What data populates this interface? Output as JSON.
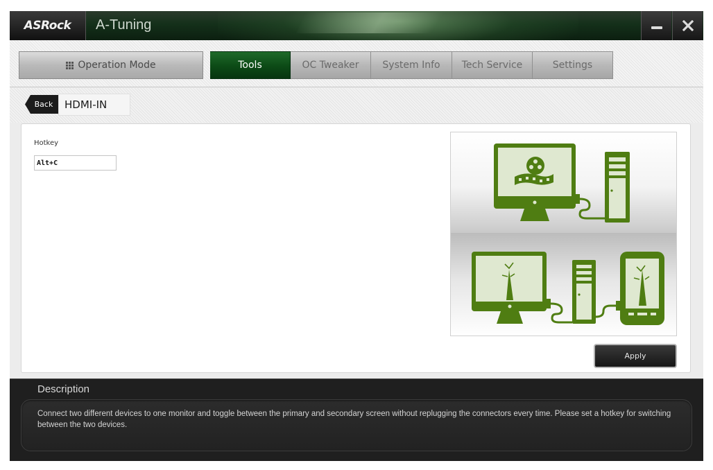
{
  "window": {
    "brand": "ASRock",
    "title": "A-Tuning"
  },
  "toolbar": {
    "operation_mode_label": "Operation Mode",
    "tabs": [
      {
        "label": "Tools",
        "active": true
      },
      {
        "label": "OC Tweaker",
        "active": false
      },
      {
        "label": "System Info",
        "active": false
      },
      {
        "label": "Tech Service",
        "active": false
      },
      {
        "label": "Settings",
        "active": false
      }
    ]
  },
  "breadcrumb": {
    "back_label": "Back",
    "page_title": "HDMI-IN"
  },
  "main": {
    "hotkey_label": "Hotkey",
    "hotkey_value": "Alt+C",
    "apply_label": "Apply"
  },
  "colors": {
    "accent_green": "#0c4a16",
    "illustration_green": "#4f7d12",
    "description_bg": "#1f1f1f"
  },
  "description": {
    "title": "Description",
    "text": "Connect two different devices to one monitor and toggle between the primary and secondary screen without replugging the connectors every time. Please set a hotkey for switching between the two devices."
  }
}
